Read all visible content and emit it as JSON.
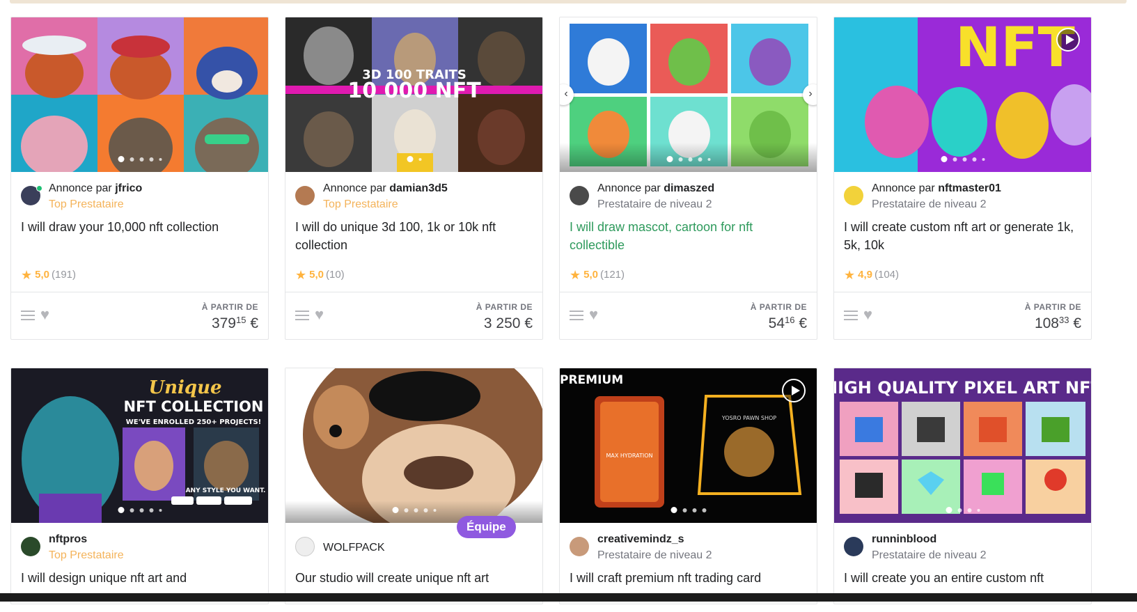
{
  "colors": {
    "accent_green": "#1dbf73",
    "star": "#ffb33e",
    "top_rated": "#f4b35a",
    "team_badge": "#8f5ae0"
  },
  "common": {
    "by_prefix": "Annonce par ",
    "price_label": "À PARTIR DE"
  },
  "cards": [
    {
      "seller": "jfrico",
      "level": "Top Prestataire",
      "title": "I will draw your 10,000 nft collection",
      "score": "5,0",
      "count": "(191)",
      "price_main": "379",
      "price_cents": "15",
      "currency": "€",
      "image_text": ""
    },
    {
      "seller": "damian3d5",
      "level": "Top Prestataire",
      "title": "I will do unique 3d 100, 1k or 10k nft collection",
      "score": "5,0",
      "count": "(10)",
      "price_main": "3 250",
      "price_cents": "",
      "currency": "€",
      "image_text": "10 000 NFT",
      "image_text_2": "3D 100 TRAITS"
    },
    {
      "seller": "dimaszed",
      "level": "Prestataire de niveau 2",
      "title": "I will draw mascot, cartoon for nft collectible",
      "score": "5,0",
      "count": "(121)",
      "price_main": "54",
      "price_cents": "16",
      "currency": "€"
    },
    {
      "seller": "nftmaster01",
      "level": "Prestataire de niveau 2",
      "title": "I will create custom nft art or generate 1k, 5k, 10k",
      "score": "4,9",
      "count": "(104)",
      "price_main": "108",
      "price_cents": "33",
      "currency": "€",
      "image_text": "NFT"
    },
    {
      "seller": "nftpros",
      "level": "Top Prestataire",
      "title": "I will design unique nft art and",
      "image_text": "Unique",
      "image_text_2": "NFT COLLECTION",
      "image_text_3": "WE'VE ENROLLED 250+ PROJECTS!",
      "image_text_4": "ANY STYLE YOU WANT."
    },
    {
      "seller": "WOLFPACK",
      "level": "",
      "title": "Our studio will create unique nft art",
      "badge": "Équipe"
    },
    {
      "seller": "creativemindz_s",
      "level": "Prestataire de niveau 2",
      "title": "I will craft premium nft trading card",
      "image_text": "PREMIUM",
      "image_text_2": "MAX HYDRATION",
      "image_text_3": "YOSRO PAWN SHOP"
    },
    {
      "seller": "runninblood",
      "level": "Prestataire de niveau 2",
      "title": "I will create you an entire custom nft",
      "image_text": "HIGH QUALITY PIXEL ART NFT"
    }
  ]
}
